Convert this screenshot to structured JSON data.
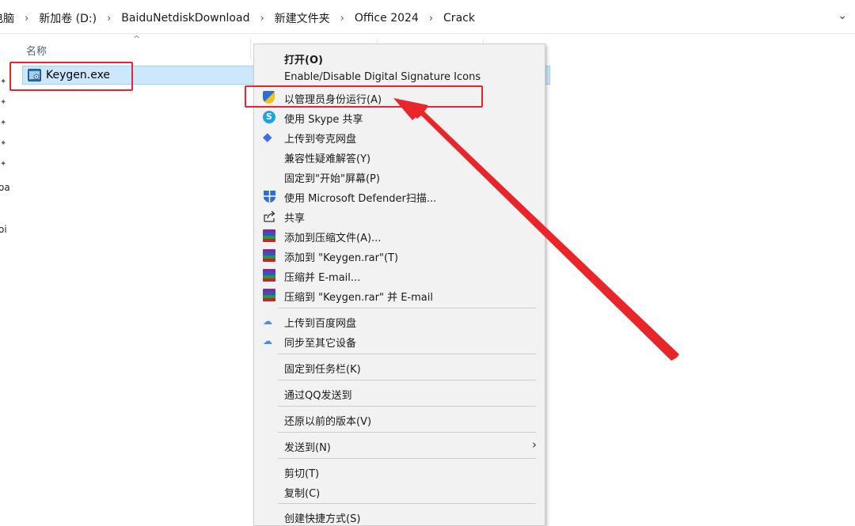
{
  "address_bar": {
    "crumbs": [
      "电脑",
      "新加卷 (D:)",
      "BaiduNetdiskDownload",
      "新建文件夹",
      "Office 2024",
      "Crack"
    ]
  },
  "nav_pane": {
    "cut_labels": [
      "oa",
      "oi"
    ]
  },
  "file_list": {
    "column_name": "名称",
    "files": [
      {
        "name": "Keygen.exe",
        "icon": "exe-icon",
        "selected": true
      }
    ]
  },
  "context_menu": {
    "items": [
      {
        "label": "打开(O)",
        "bold": true,
        "icon": ""
      },
      {
        "label": "Enable/Disable Digital Signature Icons",
        "icon": ""
      },
      {
        "label": "以管理员身份运行(A)",
        "icon": "uac-shield-icon"
      },
      {
        "label": "使用 Skype 共享",
        "icon": "skype-icon"
      },
      {
        "label": "上传到夸克网盘",
        "icon": "quark-icon"
      },
      {
        "label": "兼容性疑难解答(Y)",
        "icon": ""
      },
      {
        "label": "固定到\"开始\"屏幕(P)",
        "icon": ""
      },
      {
        "label": "使用 Microsoft Defender扫描...",
        "icon": "defender-icon"
      },
      {
        "label": "共享",
        "icon": "share-icon"
      },
      {
        "label": "添加到压缩文件(A)...",
        "icon": "winrar-icon"
      },
      {
        "label": "添加到 \"Keygen.rar\"(T)",
        "icon": "winrar-icon"
      },
      {
        "label": "压缩并 E-mail...",
        "icon": "winrar-icon"
      },
      {
        "label": "压缩到 \"Keygen.rar\" 并 E-mail",
        "icon": "winrar-icon"
      },
      {
        "label": "上传到百度网盘",
        "icon": "baidu-netdisk-icon"
      },
      {
        "label": "同步至其它设备",
        "icon": "baidu-netdisk-icon"
      },
      {
        "label": "固定到任务栏(K)",
        "icon": ""
      },
      {
        "label": "通过QQ发送到",
        "icon": ""
      },
      {
        "label": "还原以前的版本(V)",
        "icon": ""
      },
      {
        "label": "发送到(N)",
        "icon": "",
        "submenu": true
      },
      {
        "label": "剪切(T)",
        "icon": ""
      },
      {
        "label": "复制(C)",
        "icon": ""
      },
      {
        "label": "创建快捷方式(S)",
        "icon": ""
      }
    ]
  },
  "annotations": {
    "highlight_color": "#e8262a"
  },
  "colors": {
    "selection_bg": "#cce8ff",
    "selection_border": "#99d1ff",
    "menu_bg": "#f2f2f2"
  }
}
